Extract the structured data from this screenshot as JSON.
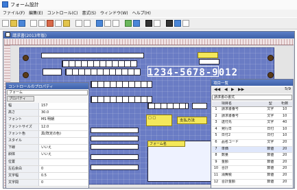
{
  "window": {
    "title": "フォーム設計"
  },
  "menu": [
    "ファイル(F)",
    "編集(E)",
    "コントロール(C)",
    "書式(S)",
    "ウィンドウ(W)",
    "ヘルプ(H)"
  ],
  "document": {
    "title": "請求書(2013年版)",
    "phone_number": "1234-5678-9012"
  },
  "form_labels": {
    "checkbox_left": "□ □",
    "payment_label": "支払方法",
    "bottom_label": "フォーム名"
  },
  "properties": {
    "title": "コントロールのプロパティ",
    "object_selector": "フォーム",
    "tab": "プロパティ",
    "rows": [
      {
        "key": "幅",
        "value": "157"
      },
      {
        "key": "高さ",
        "value": "30.0"
      },
      {
        "key": "フォント",
        "value": "MS 明朝"
      },
      {
        "key": "フォントサイズ",
        "value": "12.0"
      },
      {
        "key": "フォント色",
        "value": "黒(既定の色)"
      },
      {
        "key": "スタイル",
        "value": ""
      },
      {
        "key": "下線",
        "value": "いいえ"
      },
      {
        "key": "斜体",
        "value": "いいえ"
      },
      {
        "key": "位置",
        "value": ""
      },
      {
        "key": "左右余白",
        "value": "0"
      },
      {
        "key": "文字幅",
        "value": "0.5"
      },
      {
        "key": "文字間",
        "value": "0"
      }
    ]
  },
  "items": {
    "title": "項目一覧",
    "nav": {
      "first": "◀◀",
      "prev": "◀",
      "next": "▶",
      "last": "▶▶",
      "counter": "5/9"
    },
    "selector": "請求書の書式",
    "headers": [
      "",
      "項目名",
      "型",
      "桁数"
    ],
    "rows": [
      {
        "no": "1",
        "name": "請求書番号",
        "type": "文字",
        "len": "10"
      },
      {
        "no": "2",
        "name": "請求書番号",
        "type": "文字",
        "len": "10"
      },
      {
        "no": "3",
        "name": "送付先",
        "type": "文字",
        "len": "40"
      },
      {
        "no": "4",
        "name": "発行日",
        "type": "日付",
        "len": "10"
      },
      {
        "no": "5",
        "name": "日付2",
        "type": "日付",
        "len": "10"
      },
      {
        "no": "6",
        "name": "品名コード",
        "type": "文字",
        "len": "20"
      },
      {
        "no": "7",
        "name": "単価",
        "type": "数値",
        "len": "20"
      },
      {
        "no": "8",
        "name": "数量",
        "type": "数値",
        "len": "20"
      },
      {
        "no": "9",
        "name": "金額",
        "type": "数値",
        "len": "20"
      },
      {
        "no": "10",
        "name": "合計",
        "type": "数値",
        "len": "20"
      },
      {
        "no": "11",
        "name": "消費税",
        "type": "数値",
        "len": "20"
      },
      {
        "no": "12",
        "name": "合計金額",
        "type": "数値",
        "len": "20"
      }
    ]
  }
}
